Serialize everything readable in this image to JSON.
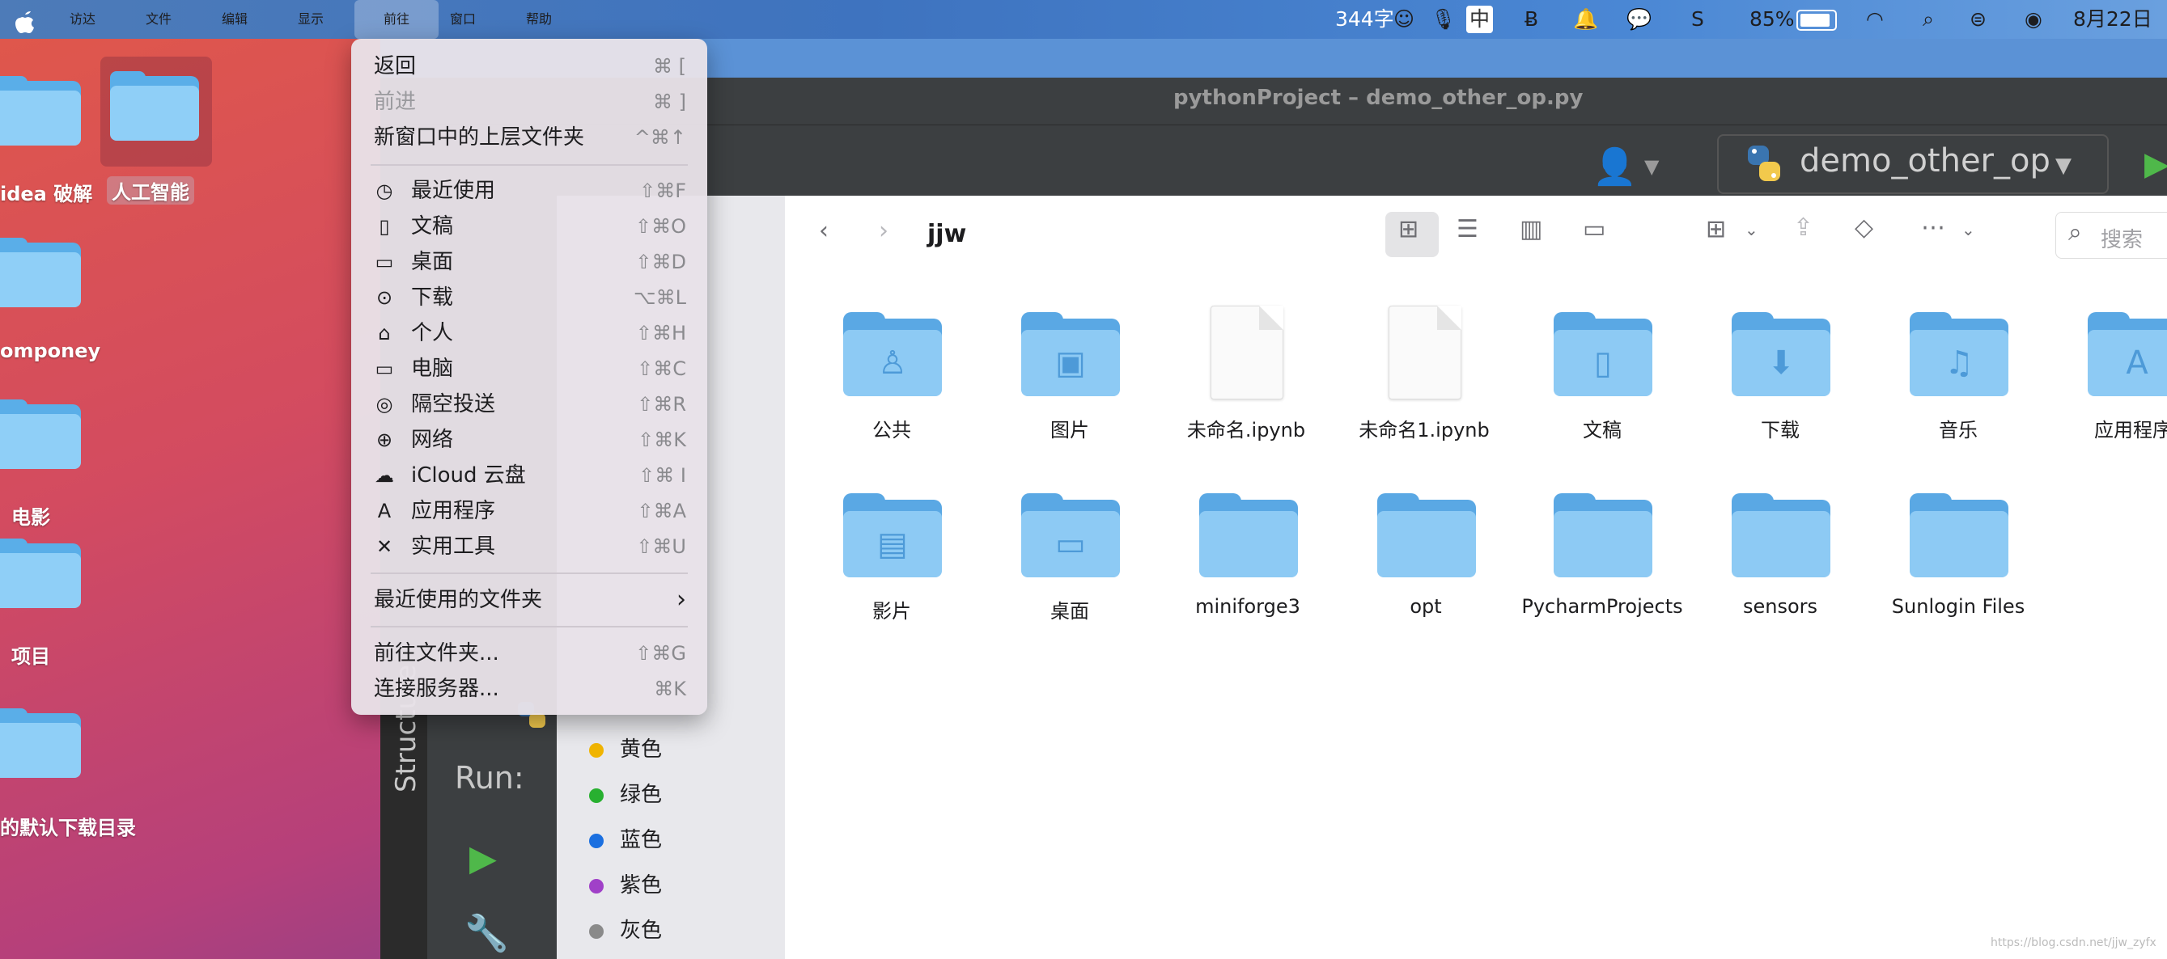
{
  "menubar": {
    "apple": "",
    "items": [
      "访达",
      "文件",
      "编辑",
      "显示",
      "前往",
      "窗口",
      "帮助"
    ],
    "active": "前往",
    "tray": {
      "word_count": "344字",
      "ime": "中",
      "battery": "85%",
      "date": "8月22日"
    }
  },
  "desktop": {
    "items": [
      "idea 破解",
      "人工智能",
      "omponey",
      "电影",
      "项目",
      "的默认下载目录"
    ]
  },
  "pycharm": {
    "title": "pythonProject – demo_other_op.py",
    "run_config": "demo_other_op",
    "run_label": "Run:",
    "structure_label": "Structure"
  },
  "go_menu": {
    "items": [
      {
        "label": "返回",
        "shortcut": "⌘ [",
        "icon": "",
        "disabled": false
      },
      {
        "label": "前进",
        "shortcut": "⌘ ]",
        "icon": "",
        "disabled": true
      },
      {
        "label": "新窗口中的上层文件夹",
        "shortcut": "^⌘↑",
        "icon": "",
        "disabled": false
      },
      {
        "label": "最近使用",
        "shortcut": "⇧⌘F",
        "icon": "clock-icon",
        "disabled": false
      },
      {
        "label": "文稿",
        "shortcut": "⇧⌘O",
        "icon": "document-icon",
        "disabled": false
      },
      {
        "label": "桌面",
        "shortcut": "⇧⌘D",
        "icon": "desktop-icon",
        "disabled": false
      },
      {
        "label": "下载",
        "shortcut": "⌥⌘L",
        "icon": "download-icon",
        "disabled": false
      },
      {
        "label": "个人",
        "shortcut": "⇧⌘H",
        "icon": "home-icon",
        "disabled": false
      },
      {
        "label": "电脑",
        "shortcut": "⇧⌘C",
        "icon": "laptop-icon",
        "disabled": false
      },
      {
        "label": "隔空投送",
        "shortcut": "⇧⌘R",
        "icon": "airdrop-icon",
        "disabled": false
      },
      {
        "label": "网络",
        "shortcut": "⇧⌘K",
        "icon": "globe-icon",
        "disabled": false
      },
      {
        "label": "iCloud 云盘",
        "shortcut": "⇧⌘ I",
        "icon": "cloud-icon",
        "disabled": false
      },
      {
        "label": "应用程序",
        "shortcut": "⇧⌘A",
        "icon": "apps-icon",
        "disabled": false
      },
      {
        "label": "实用工具",
        "shortcut": "⇧⌘U",
        "icon": "tools-icon",
        "disabled": false
      },
      {
        "label": "最近使用的文件夹",
        "shortcut": "›",
        "icon": "",
        "disabled": false
      },
      {
        "label": "前往文件夹...",
        "shortcut": "⇧⌘G",
        "icon": "",
        "disabled": false
      },
      {
        "label": "连接服务器...",
        "shortcut": "⌘K",
        "icon": "",
        "disabled": false
      }
    ]
  },
  "finder": {
    "path": "jjw",
    "search_placeholder": "搜索",
    "tags": [
      {
        "label": "黄色",
        "color": "#f0b400"
      },
      {
        "label": "绿色",
        "color": "#28b030"
      },
      {
        "label": "蓝色",
        "color": "#1a6fe0"
      },
      {
        "label": "紫色",
        "color": "#a040c8"
      },
      {
        "label": "灰色",
        "color": "#8a8a8a"
      }
    ],
    "files": [
      {
        "name": "公共",
        "kind": "folder",
        "glyph": "♙"
      },
      {
        "name": "图片",
        "kind": "folder",
        "glyph": "▣"
      },
      {
        "name": "未命名.ipynb",
        "kind": "doc",
        "glyph": ""
      },
      {
        "name": "未命名1.ipynb",
        "kind": "doc",
        "glyph": ""
      },
      {
        "name": "文稿",
        "kind": "folder",
        "glyph": "▯"
      },
      {
        "name": "下载",
        "kind": "folder",
        "glyph": "⬇"
      },
      {
        "name": "音乐",
        "kind": "folder",
        "glyph": "♫"
      },
      {
        "name": "应用程序",
        "kind": "folder",
        "glyph": "A"
      },
      {
        "name": "影片",
        "kind": "folder",
        "glyph": "▤"
      },
      {
        "name": "桌面",
        "kind": "folder",
        "glyph": "▭"
      },
      {
        "name": "miniforge3",
        "kind": "folder",
        "glyph": ""
      },
      {
        "name": "opt",
        "kind": "folder",
        "glyph": ""
      },
      {
        "name": "PycharmProjects",
        "kind": "folder",
        "glyph": ""
      },
      {
        "name": "sensors",
        "kind": "folder",
        "glyph": ""
      },
      {
        "name": "Sunlogin Files",
        "kind": "folder",
        "glyph": ""
      }
    ]
  },
  "watermark": "https://blog.csdn.net/jjw_zyfx"
}
